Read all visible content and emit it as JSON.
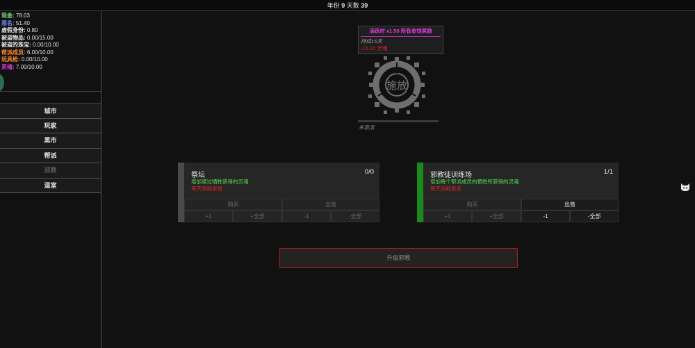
{
  "topbar": {
    "year_label": "年份",
    "year": "9",
    "day_label": "天数",
    "day": "39"
  },
  "stats": [
    {
      "label": "现金:",
      "value": "78.03",
      "color": "#7fdc7f"
    },
    {
      "label": "恶名:",
      "value": "51.40",
      "color": "#6f8fff"
    },
    {
      "label": "虚假身份:",
      "value": "0.80",
      "color": "#e8e8e8"
    },
    {
      "label": "被盗物品:",
      "value": "0.00/15.00",
      "color": "#e8e8e8"
    },
    {
      "label": "被盗的珠宝:",
      "value": "0.00/10.00",
      "color": "#e8e8e8"
    },
    {
      "label": "帮派成员:",
      "value": "6.00/10.00",
      "color": "#ff8a2a"
    },
    {
      "label": "玩具枪:",
      "value": "0.00/10.00",
      "color": "#ff8a2a"
    },
    {
      "label": "灵魂:",
      "value": "7.00/10.00",
      "color": "#e03ce0"
    }
  ],
  "nav": {
    "city": "城市",
    "player": "玩家",
    "black_market": "黑市",
    "gang": "帮派",
    "cult": "邪教",
    "greenhouse": "温室"
  },
  "ritual": {
    "buff_title": "活跃时 x1.50 所有金钱奖励",
    "duration": "持续15天",
    "cost": "-15.00 灵魂",
    "sigil_label": "施放",
    "progress": 0,
    "status": "未激活"
  },
  "cards": {
    "altar": {
      "name": "祭坛",
      "count": "0/0",
      "desc": "增加通过牺牲获得的灵魂",
      "cost": "每天消耗金钱",
      "bar_color": "#4a4a4a",
      "buy": "购买",
      "sell": "出售",
      "plus1": "+1",
      "plus_all": "+全部",
      "minus1": "-1",
      "minus_all": "-全部"
    },
    "training": {
      "name": "邪教徒训练场",
      "count": "1/1",
      "desc": "增加每个帮派成员的牺牲所获得的灵魂",
      "cost": "每天消耗恶名",
      "bar_color": "#1a8a1a",
      "buy": "购买",
      "sell": "出售",
      "plus1": "+1",
      "plus_all": "+全部",
      "minus1": "-1",
      "minus_all": "-全部"
    }
  },
  "upgrade_label": "升级邪教"
}
